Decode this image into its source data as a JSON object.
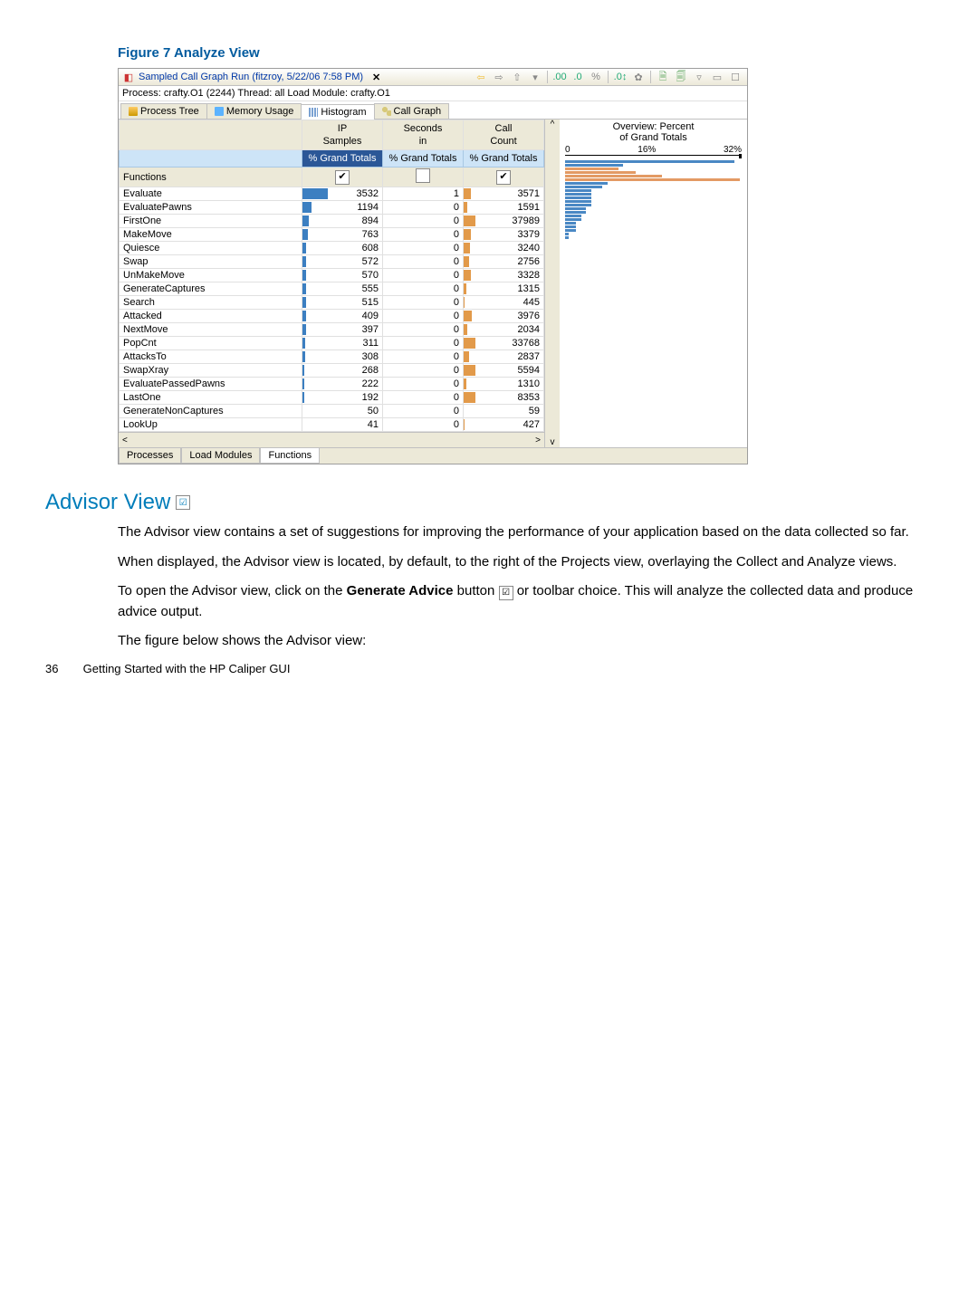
{
  "figure_caption": "Figure 7 Analyze View",
  "title_text": "Sampled Call Graph Run (fitzroy, 5/22/06 7:58 PM)",
  "close_x": "✕",
  "process_line": "Process: crafty.O1 (2244)  Thread: all  Load Module: crafty.O1",
  "main_tabs": {
    "process_tree": "Process Tree",
    "memory_usage": "Memory Usage",
    "histogram": "Histogram",
    "call_graph": "Call Graph"
  },
  "col_headers": {
    "ip": "IP\nSamples",
    "sec": "Seconds\nin",
    "call": "Call\nCount",
    "grand": "% Grand Totals",
    "functions": "Functions"
  },
  "chkboxes": {
    "on1": "✔",
    "off": "",
    "on2": "✔"
  },
  "rows": [
    {
      "fn": "Evaluate",
      "ip": 3532,
      "sec": 1,
      "call": 3571,
      "barIP": 32,
      "barCall": 9
    },
    {
      "fn": "EvaluatePawns",
      "ip": 1194,
      "sec": 0,
      "call": 1591,
      "barIP": 11,
      "barCall": 4
    },
    {
      "fn": "FirstOne",
      "ip": 894,
      "sec": 0,
      "call": 37989,
      "barIP": 8,
      "barCall": 100
    },
    {
      "fn": "MakeMove",
      "ip": 763,
      "sec": 0,
      "call": 3379,
      "barIP": 7,
      "barCall": 9
    },
    {
      "fn": "Quiesce",
      "ip": 608,
      "sec": 0,
      "call": 3240,
      "barIP": 5,
      "barCall": 8
    },
    {
      "fn": "Swap",
      "ip": 572,
      "sec": 0,
      "call": 2756,
      "barIP": 5,
      "barCall": 7
    },
    {
      "fn": "UnMakeMove",
      "ip": 570,
      "sec": 0,
      "call": 3328,
      "barIP": 5,
      "barCall": 9
    },
    {
      "fn": "GenerateCaptures",
      "ip": 555,
      "sec": 0,
      "call": 1315,
      "barIP": 5,
      "barCall": 3
    },
    {
      "fn": "Search",
      "ip": 515,
      "sec": 0,
      "call": 445,
      "barIP": 5,
      "barCall": 1
    },
    {
      "fn": "Attacked",
      "ip": 409,
      "sec": 0,
      "call": 3976,
      "barIP": 4,
      "barCall": 10
    },
    {
      "fn": "NextMove",
      "ip": 397,
      "sec": 0,
      "call": 2034,
      "barIP": 4,
      "barCall": 5
    },
    {
      "fn": "PopCnt",
      "ip": 311,
      "sec": 0,
      "call": 33768,
      "barIP": 3,
      "barCall": 89
    },
    {
      "fn": "AttacksTo",
      "ip": 308,
      "sec": 0,
      "call": 2837,
      "barIP": 3,
      "barCall": 7
    },
    {
      "fn": "SwapXray",
      "ip": 268,
      "sec": 0,
      "call": 5594,
      "barIP": 2,
      "barCall": 15
    },
    {
      "fn": "EvaluatePassedPawns",
      "ip": 222,
      "sec": 0,
      "call": 1310,
      "barIP": 2,
      "barCall": 3
    },
    {
      "fn": "LastOne",
      "ip": 192,
      "sec": 0,
      "call": 8353,
      "barIP": 2,
      "barCall": 22
    },
    {
      "fn": "GenerateNonCaptures",
      "ip": 50,
      "sec": 0,
      "call": 59,
      "barIP": 0,
      "barCall": 0
    },
    {
      "fn": "LookUp",
      "ip": 41,
      "sec": 0,
      "call": 427,
      "barIP": 0,
      "barCall": 1
    }
  ],
  "overview": {
    "title": "Overview: Percent\nof Grand Totals",
    "axis": {
      "a": "0",
      "b": "16%",
      "c": "32%"
    }
  },
  "bottom_tabs": {
    "p": "Processes",
    "l": "Load Modules",
    "f": "Functions"
  },
  "section": "Advisor View",
  "para1": "The Advisor view contains a set of suggestions for improving the performance of your application based on the data collected so far.",
  "para2": "When displayed, the Advisor view is located, by default, to the right of the Projects view, overlaying the Collect and Analyze views.",
  "para3a": "To open the Advisor view, click on the ",
  "para3b": "Generate Advice",
  "para3c": " button ",
  "para3d": " or toolbar choice. This will analyze the collected data and produce advice output.",
  "para4": "The figure below shows the Advisor view:",
  "footer_page": "36",
  "footer_text": "Getting Started with the HP Caliper GUI"
}
